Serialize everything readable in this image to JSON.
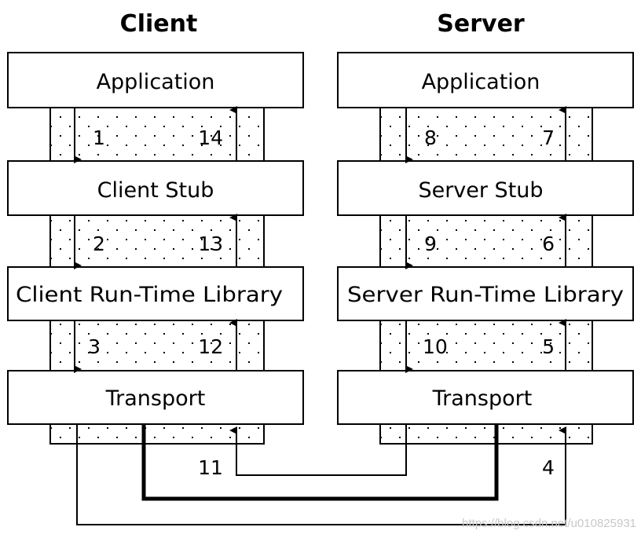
{
  "columns": [
    {
      "title": "Client",
      "layers": [
        "Application",
        "Client Stub",
        "Client Run-Time Library",
        "Transport"
      ],
      "down_steps": [
        "1",
        "2",
        "3"
      ],
      "up_steps": [
        "14",
        "13",
        "12"
      ]
    },
    {
      "title": "Server",
      "layers": [
        "Application",
        "Server Stub",
        "Server Run-Time Library",
        "Transport"
      ],
      "down_steps": [
        "8",
        "9",
        "10"
      ],
      "up_steps": [
        "7",
        "6",
        "5"
      ]
    }
  ],
  "network_steps": {
    "to_client": "11",
    "to_server": "4"
  },
  "watermark": "https://blog.csdn.net/u010825931",
  "colors": {
    "line": "#000000",
    "background": "#ffffff",
    "dots": "#000000"
  }
}
